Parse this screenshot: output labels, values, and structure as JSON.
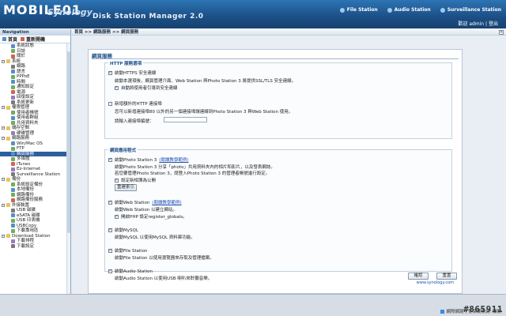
{
  "brand": {
    "logo_text": "MOBILE01",
    "vendor": "Synology",
    "product": "Disk Station Manager 2.0"
  },
  "toplinks": {
    "file_station": "File Station",
    "audio_station": "Audio Station",
    "surveillance_station": "Surveillance Station"
  },
  "user": {
    "welcome": "歡迎 admin",
    "logout": "登出"
  },
  "nav": {
    "header": "Navigation",
    "tab_home": "首頁",
    "tab_quick": "重新開機",
    "items": [
      {
        "label": "系統狀態",
        "level": 1
      },
      {
        "label": "日誌",
        "level": 1
      },
      {
        "label": "關於",
        "level": 1
      },
      {
        "label": "系統",
        "level": 0
      },
      {
        "label": "網路",
        "level": 1
      },
      {
        "label": "語言",
        "level": 1
      },
      {
        "label": "PPPoE",
        "level": 1
      },
      {
        "label": "時間",
        "level": 1
      },
      {
        "label": "通知設定",
        "level": 1
      },
      {
        "label": "電源",
        "level": 1
      },
      {
        "label": "回復設定",
        "level": 1
      },
      {
        "label": "系統更新",
        "level": 1
      },
      {
        "label": "權限管理",
        "level": 0
      },
      {
        "label": "使用者帳號",
        "level": 1
      },
      {
        "label": "使用者群組",
        "level": 1
      },
      {
        "label": "共用資料夾",
        "level": 1
      },
      {
        "label": "儲存空間",
        "level": 0
      },
      {
        "label": "硬碟管理",
        "level": 1
      },
      {
        "label": "網路服務",
        "level": 0
      },
      {
        "label": "Win/Mac OS",
        "level": 1
      },
      {
        "label": "FTP",
        "level": 1
      },
      {
        "label": "網頁服務",
        "level": 1,
        "selected": true
      },
      {
        "label": "多媒體",
        "level": 1
      },
      {
        "label": "iTunes",
        "level": 1
      },
      {
        "label": "Ez-Internet",
        "level": 1
      },
      {
        "label": "Surveillance Station",
        "level": 1
      },
      {
        "label": "備份",
        "level": 0
      },
      {
        "label": "系統設定備份",
        "level": 1
      },
      {
        "label": "本地備份",
        "level": 1
      },
      {
        "label": "網路備份",
        "level": 1
      },
      {
        "label": "網路備份服務",
        "level": 1
      },
      {
        "label": "外接裝置",
        "level": 0
      },
      {
        "label": "USB 磁碟",
        "level": 1
      },
      {
        "label": "eSATA 磁碟",
        "level": 1
      },
      {
        "label": "USB 印表機",
        "level": 1
      },
      {
        "label": "USBCopy",
        "level": 1
      },
      {
        "label": "下載專用區",
        "level": 1
      },
      {
        "label": "Download Station",
        "level": 0
      },
      {
        "label": "下載排程",
        "level": 1
      },
      {
        "label": "下載設定",
        "level": 1
      }
    ]
  },
  "breadcrumb": "首頁 >> 網路服務 >> 網頁服務",
  "panel": {
    "title": "網頁服務",
    "http_legend": "HTTP 服務選項",
    "https_label": "啟動HTTPS 安全連線",
    "https_desc": "啟動本選項後，網頁管理介面、Web Station 與Photo Station 3 將提供SSL/TLS 安全連線。",
    "redirect_label": "自動將使用者引導到安全連線",
    "custom_port_label": "新增額外的HTTP 連接埠",
    "custom_port_desc": "您可以新增連接埠80 以外的另一個連接埠讓連線到Photo Station 3 與Web Station 使用。",
    "port_prompt": "請輸入連接埠編號：",
    "app_legend": "網頁應用程式",
    "photo_label": "啟動Photo Station 3",
    "photo_link": "(閱讀教學範例)",
    "photo_desc1": "啟動Photo Station 3 分享「photo」共用資料夾內的相片和影片，以及發表網誌。",
    "photo_desc2": "若您要管理Photo Station 3，請登入Photo Station 3 的管理者帳號進行設定。",
    "personal_label": "設定新相簿為公開",
    "reindex_button": "重建索引",
    "web_label": "啟動Web Station",
    "web_link": "(閱讀教學範例)",
    "web_desc": "啟動Web Station 以建立網站。",
    "php_label": "開啟PHP 設定register_globals。",
    "mysql_label": "啟動MySQL",
    "mysql_desc": "啟動MySQL 以使用MySQL 資料庫功能。",
    "file_label": "啟動File Station",
    "file_desc": "啟動File Station 以使用瀏覽器來存取及管理檔案。",
    "audio_label": "啟動Audio Station",
    "audio_desc": "啟動Audio Station 以使用USB 喇叭來聆聽音樂。",
    "ok_button": "確認",
    "reset_button": "重置",
    "footer_link": "www.synology.com"
  },
  "status": {
    "zone": "網際網路 | 受保護模式: 關閉",
    "watermark": "#865911"
  }
}
